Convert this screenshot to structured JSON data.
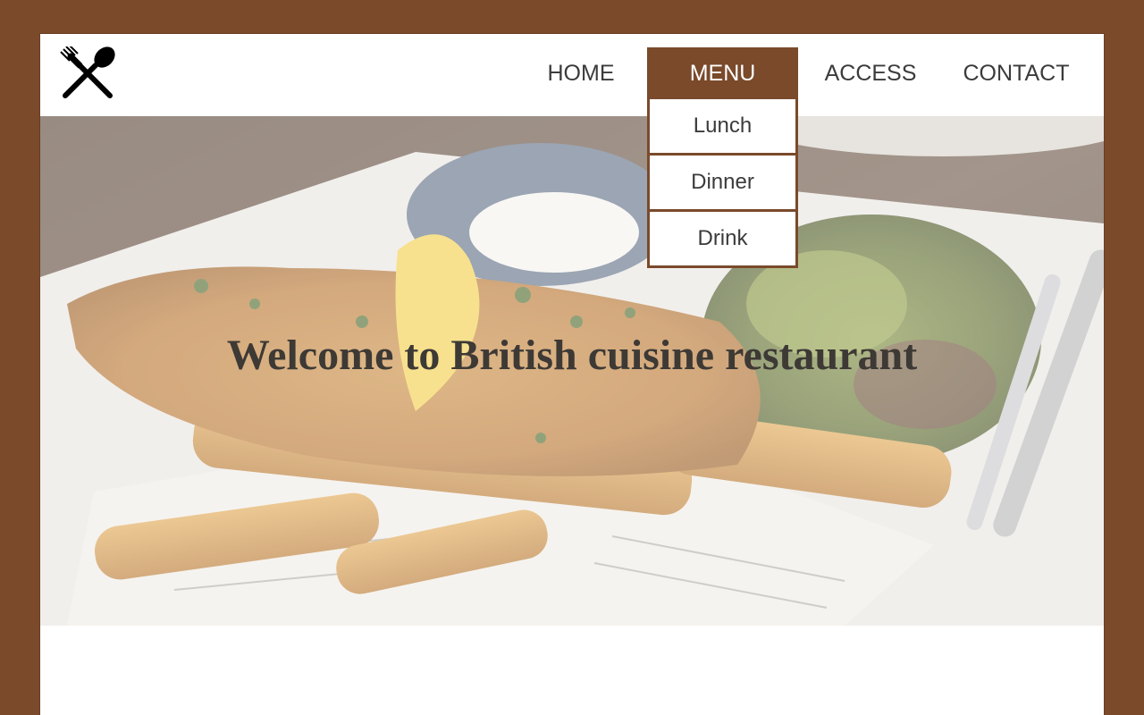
{
  "nav": {
    "items": [
      {
        "label": "HOME",
        "active": false
      },
      {
        "label": "MENU",
        "active": true
      },
      {
        "label": "ACCESS",
        "active": false
      },
      {
        "label": "CONTACT",
        "active": false
      }
    ]
  },
  "menu_dropdown": {
    "items": [
      "Lunch",
      "Dinner",
      "Drink"
    ]
  },
  "hero": {
    "title": "Welcome to British cuisine restaurant"
  },
  "colors": {
    "brand": "#7a4a2b",
    "text": "#3b3b3b",
    "background": "#ffffff"
  },
  "icons": {
    "logo": "fork-and-spoon-icon"
  }
}
